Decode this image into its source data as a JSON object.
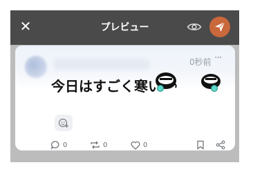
{
  "header": {
    "title": "プレビュー",
    "close_icon": "close-icon",
    "eye_icon": "eye-icon",
    "send_icon": "send-icon",
    "send_color": "#c9683b",
    "bar_color": "#4a4a4a"
  },
  "post": {
    "timestamp": "0秒前",
    "more_label": "···",
    "text": "今日はすごく寒い",
    "reply_count": "0",
    "repost_count": "0",
    "like_count": "0"
  }
}
